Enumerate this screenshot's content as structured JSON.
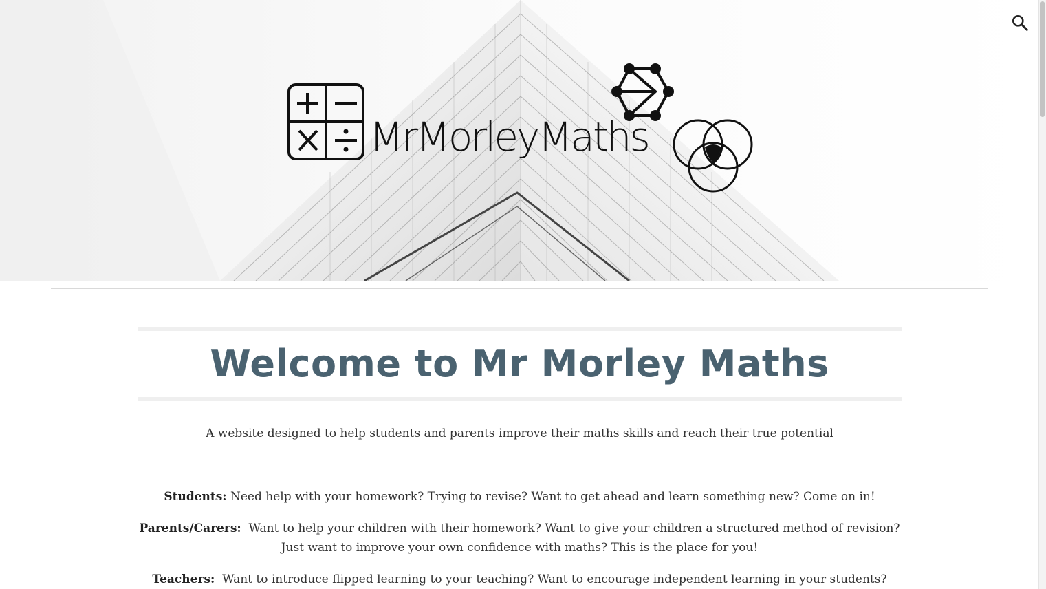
{
  "header": {
    "logo_text": "MrMorleyMaths",
    "search_icon": "search-icon"
  },
  "main": {
    "title": "Welcome to Mr Morley Maths",
    "tagline": "A website designed to help students and parents improve their maths skills and reach their true potential",
    "sections": [
      {
        "label": "Students:",
        "text": "Need help with your homework?  Trying to revise?  Want to get ahead and learn something new?  Come on in!"
      },
      {
        "label": "Parents/Carers:",
        "text": "Want to help your children with their homework?  Want to give your children a structured method of revision?  Just want to improve your own confidence with maths?  This is the place for you!"
      },
      {
        "label": "Teachers:",
        "text": "Want to introduce flipped learning to your teaching?  Want to encourage independent learning in your students?  Welcome!"
      }
    ]
  },
  "colors": {
    "title": "#4a6270",
    "body_text": "#333333",
    "divider": "#d9d9d9"
  }
}
